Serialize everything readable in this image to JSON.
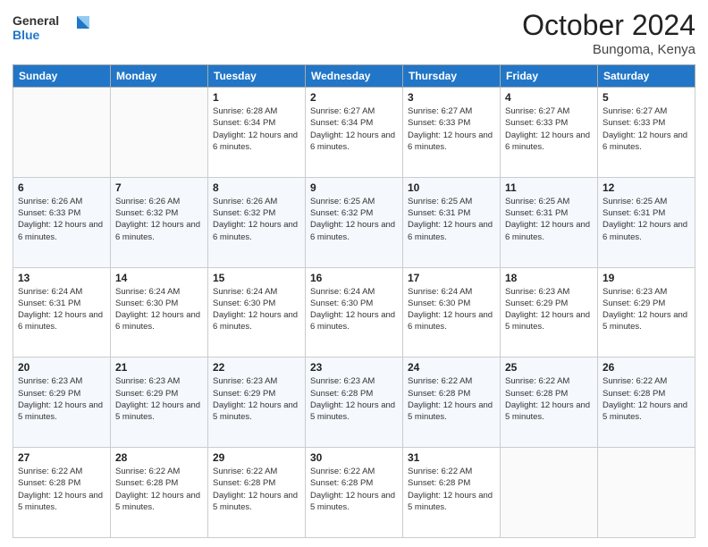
{
  "header": {
    "logo": {
      "line1": "General",
      "line2": "Blue"
    },
    "title": "October 2024",
    "location": "Bungoma, Kenya"
  },
  "days_of_week": [
    "Sunday",
    "Monday",
    "Tuesday",
    "Wednesday",
    "Thursday",
    "Friday",
    "Saturday"
  ],
  "weeks": [
    [
      {
        "day": "",
        "info": ""
      },
      {
        "day": "",
        "info": ""
      },
      {
        "day": "1",
        "info": "Sunrise: 6:28 AM\nSunset: 6:34 PM\nDaylight: 12 hours and 6 minutes."
      },
      {
        "day": "2",
        "info": "Sunrise: 6:27 AM\nSunset: 6:34 PM\nDaylight: 12 hours and 6 minutes."
      },
      {
        "day": "3",
        "info": "Sunrise: 6:27 AM\nSunset: 6:33 PM\nDaylight: 12 hours and 6 minutes."
      },
      {
        "day": "4",
        "info": "Sunrise: 6:27 AM\nSunset: 6:33 PM\nDaylight: 12 hours and 6 minutes."
      },
      {
        "day": "5",
        "info": "Sunrise: 6:27 AM\nSunset: 6:33 PM\nDaylight: 12 hours and 6 minutes."
      }
    ],
    [
      {
        "day": "6",
        "info": "Sunrise: 6:26 AM\nSunset: 6:33 PM\nDaylight: 12 hours and 6 minutes."
      },
      {
        "day": "7",
        "info": "Sunrise: 6:26 AM\nSunset: 6:32 PM\nDaylight: 12 hours and 6 minutes."
      },
      {
        "day": "8",
        "info": "Sunrise: 6:26 AM\nSunset: 6:32 PM\nDaylight: 12 hours and 6 minutes."
      },
      {
        "day": "9",
        "info": "Sunrise: 6:25 AM\nSunset: 6:32 PM\nDaylight: 12 hours and 6 minutes."
      },
      {
        "day": "10",
        "info": "Sunrise: 6:25 AM\nSunset: 6:31 PM\nDaylight: 12 hours and 6 minutes."
      },
      {
        "day": "11",
        "info": "Sunrise: 6:25 AM\nSunset: 6:31 PM\nDaylight: 12 hours and 6 minutes."
      },
      {
        "day": "12",
        "info": "Sunrise: 6:25 AM\nSunset: 6:31 PM\nDaylight: 12 hours and 6 minutes."
      }
    ],
    [
      {
        "day": "13",
        "info": "Sunrise: 6:24 AM\nSunset: 6:31 PM\nDaylight: 12 hours and 6 minutes."
      },
      {
        "day": "14",
        "info": "Sunrise: 6:24 AM\nSunset: 6:30 PM\nDaylight: 12 hours and 6 minutes."
      },
      {
        "day": "15",
        "info": "Sunrise: 6:24 AM\nSunset: 6:30 PM\nDaylight: 12 hours and 6 minutes."
      },
      {
        "day": "16",
        "info": "Sunrise: 6:24 AM\nSunset: 6:30 PM\nDaylight: 12 hours and 6 minutes."
      },
      {
        "day": "17",
        "info": "Sunrise: 6:24 AM\nSunset: 6:30 PM\nDaylight: 12 hours and 6 minutes."
      },
      {
        "day": "18",
        "info": "Sunrise: 6:23 AM\nSunset: 6:29 PM\nDaylight: 12 hours and 5 minutes."
      },
      {
        "day": "19",
        "info": "Sunrise: 6:23 AM\nSunset: 6:29 PM\nDaylight: 12 hours and 5 minutes."
      }
    ],
    [
      {
        "day": "20",
        "info": "Sunrise: 6:23 AM\nSunset: 6:29 PM\nDaylight: 12 hours and 5 minutes."
      },
      {
        "day": "21",
        "info": "Sunrise: 6:23 AM\nSunset: 6:29 PM\nDaylight: 12 hours and 5 minutes."
      },
      {
        "day": "22",
        "info": "Sunrise: 6:23 AM\nSunset: 6:29 PM\nDaylight: 12 hours and 5 minutes."
      },
      {
        "day": "23",
        "info": "Sunrise: 6:23 AM\nSunset: 6:28 PM\nDaylight: 12 hours and 5 minutes."
      },
      {
        "day": "24",
        "info": "Sunrise: 6:22 AM\nSunset: 6:28 PM\nDaylight: 12 hours and 5 minutes."
      },
      {
        "day": "25",
        "info": "Sunrise: 6:22 AM\nSunset: 6:28 PM\nDaylight: 12 hours and 5 minutes."
      },
      {
        "day": "26",
        "info": "Sunrise: 6:22 AM\nSunset: 6:28 PM\nDaylight: 12 hours and 5 minutes."
      }
    ],
    [
      {
        "day": "27",
        "info": "Sunrise: 6:22 AM\nSunset: 6:28 PM\nDaylight: 12 hours and 5 minutes."
      },
      {
        "day": "28",
        "info": "Sunrise: 6:22 AM\nSunset: 6:28 PM\nDaylight: 12 hours and 5 minutes."
      },
      {
        "day": "29",
        "info": "Sunrise: 6:22 AM\nSunset: 6:28 PM\nDaylight: 12 hours and 5 minutes."
      },
      {
        "day": "30",
        "info": "Sunrise: 6:22 AM\nSunset: 6:28 PM\nDaylight: 12 hours and 5 minutes."
      },
      {
        "day": "31",
        "info": "Sunrise: 6:22 AM\nSunset: 6:28 PM\nDaylight: 12 hours and 5 minutes."
      },
      {
        "day": "",
        "info": ""
      },
      {
        "day": "",
        "info": ""
      }
    ]
  ]
}
